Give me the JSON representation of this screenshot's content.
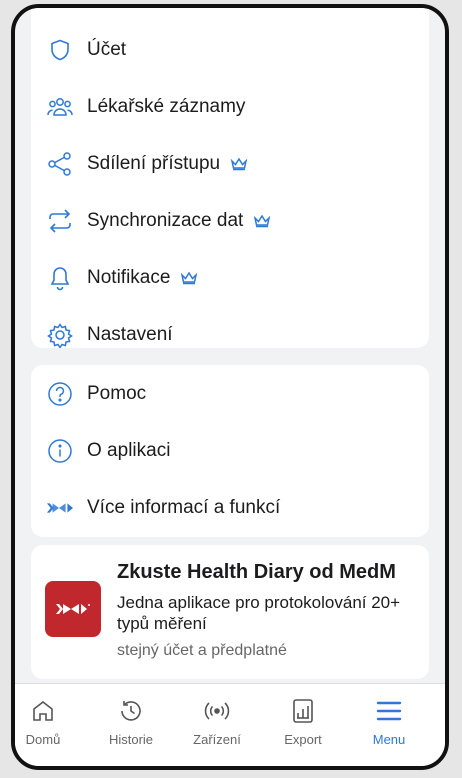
{
  "menu_primary": [
    {
      "label": "Účet",
      "icon": "shield-icon",
      "premium": false
    },
    {
      "label": "Lékařské záznamy",
      "icon": "users-icon",
      "premium": false
    },
    {
      "label": "Sdílení přístupu",
      "icon": "share-icon",
      "premium": true
    },
    {
      "label": "Synchronizace dat",
      "icon": "sync-icon",
      "premium": true
    },
    {
      "label": "Notifikace",
      "icon": "bell-icon",
      "premium": true
    },
    {
      "label": "Nastavení",
      "icon": "gear-icon",
      "premium": false
    }
  ],
  "menu_secondary": [
    {
      "label": "Pomoc",
      "icon": "help-icon"
    },
    {
      "label": "O aplikaci",
      "icon": "info-icon"
    },
    {
      "label": "Více informací a funkcí",
      "icon": "medm-logo-icon"
    }
  ],
  "promo": {
    "title": "Zkuste Health Diary od MedM",
    "description": "Jedna aplikace pro protokolování 20+ typů měření",
    "subtitle": "stejný účet a předplatné"
  },
  "nav": [
    {
      "label": "Domů",
      "icon": "home-icon",
      "active": false
    },
    {
      "label": "Historie",
      "icon": "history-icon",
      "active": false
    },
    {
      "label": "Zařízení",
      "icon": "device-icon",
      "active": false
    },
    {
      "label": "Export",
      "icon": "export-icon",
      "active": false
    },
    {
      "label": "Menu",
      "icon": "menu-icon",
      "active": true
    }
  ],
  "colors": {
    "accent": "#2f78d6",
    "brand_red": "#c0282d",
    "crown": "#2f78d6"
  }
}
